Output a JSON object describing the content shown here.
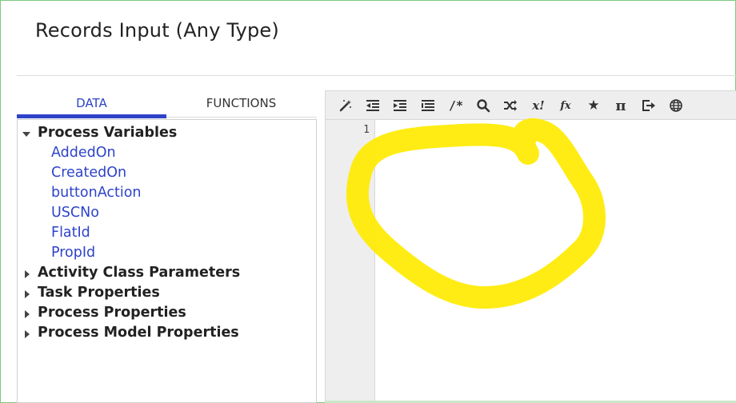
{
  "page": {
    "title": "Records Input (Any Type)"
  },
  "tabs": [
    {
      "label": "DATA",
      "active": true
    },
    {
      "label": "FUNCTIONS",
      "active": false
    }
  ],
  "tree": {
    "process_variables": {
      "label": "Process Variables",
      "expanded": true,
      "children": [
        "AddedOn",
        "CreatedOn",
        "buttonAction",
        "USCNo",
        "FlatId",
        "PropId"
      ]
    },
    "collapsed_groups": [
      "Activity Class Parameters",
      "Task Properties",
      "Process Properties",
      "Process Model Properties"
    ]
  },
  "toolbar": {
    "icons": [
      {
        "name": "magic-wand-icon",
        "glyph": "✎"
      },
      {
        "name": "outdent-icon",
        "glyph": "⇤"
      },
      {
        "name": "indent-icon",
        "glyph": "⇥"
      },
      {
        "name": "list-icon",
        "glyph": "☰"
      },
      {
        "name": "comment-icon",
        "glyph": "/*"
      },
      {
        "name": "search-icon",
        "glyph": "⌕"
      },
      {
        "name": "shuffle-icon",
        "glyph": "⤨"
      },
      {
        "name": "variable-icon",
        "glyph": "x!"
      },
      {
        "name": "function-icon",
        "glyph": "fx"
      },
      {
        "name": "star-icon",
        "glyph": "★"
      },
      {
        "name": "pi-icon",
        "glyph": "π"
      },
      {
        "name": "export-icon",
        "glyph": "⇥"
      },
      {
        "name": "globe-icon",
        "glyph": "⊕"
      }
    ]
  },
  "editor": {
    "line_numbers": [
      "1"
    ]
  },
  "colors": {
    "accent": "#2e43c8",
    "highlight": "#ffea00",
    "frame": "#7ec97e"
  }
}
